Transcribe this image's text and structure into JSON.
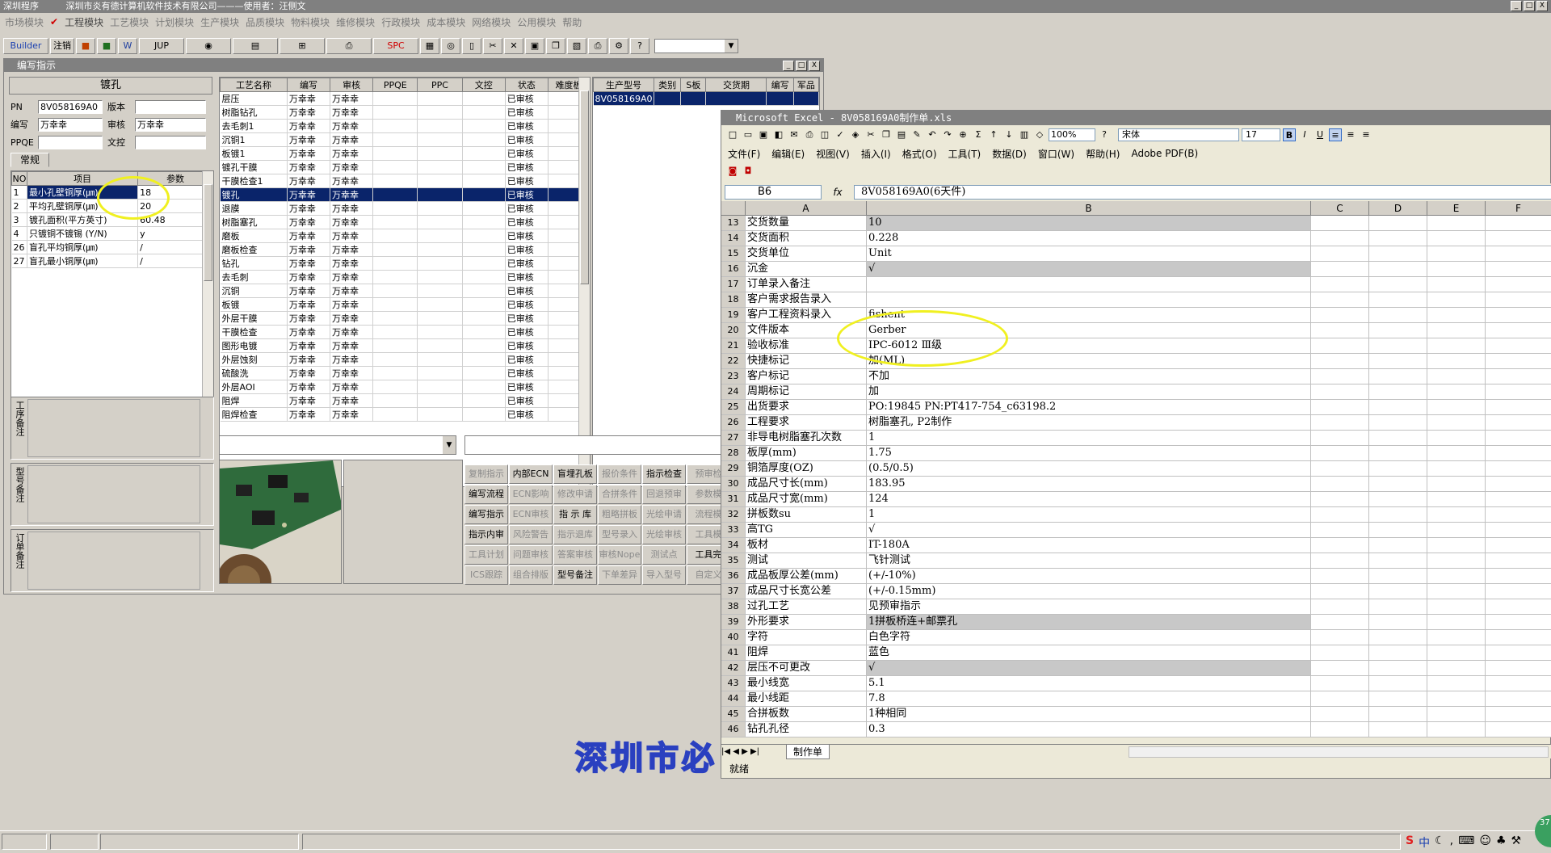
{
  "app": {
    "title": "深圳程序",
    "company_line": "深圳市炎有德计算机软件技术有限公司———使用者：汪侧文",
    "window_btn_min": "_",
    "window_btn_max": "□",
    "window_btn_close": "X"
  },
  "menu": [
    "市场模块",
    "工程模块",
    "工艺模块",
    "计划模块",
    "生产模块",
    "品质模块",
    "物料模块",
    "维修模块",
    "行政模块",
    "成本模块",
    "网络模块",
    "公用模块",
    "帮助"
  ],
  "toolbar": {
    "builder": "Builder",
    "note": "注销",
    "jup": "JUP",
    "spc": "SPC",
    "combo_value": ""
  },
  "panel": {
    "title": "编写指示",
    "section_title": "镀孔",
    "fields": {
      "pn_label": "PN",
      "pn_value": "8V058169A0",
      "version_label": "版本",
      "version_value": "",
      "author_label": "编写",
      "author_value": "万幸幸",
      "review_label": "审核",
      "review_value": "万幸幸",
      "ppqe_label": "PPQE",
      "ppqe_value": "",
      "control_label": "文控",
      "control_value": ""
    },
    "tab": "常规",
    "params_headers": [
      "NO",
      "项目",
      "参数"
    ],
    "params": [
      {
        "no": "1",
        "item": "最小孔壁铜厚(㎛)",
        "val": "18"
      },
      {
        "no": "2",
        "item": "平均孔壁铜厚(㎛)",
        "val": "20"
      },
      {
        "no": "3",
        "item": "镀孔面积(平方英寸)",
        "val": "60.48"
      },
      {
        "no": "4",
        "item": "只镀铜不镀锡 (Y/N)",
        "val": "y"
      },
      {
        "no": "26",
        "item": "盲孔平均铜厚(㎛)",
        "val": "/"
      },
      {
        "no": "27",
        "item": "盲孔最小铜厚(㎛)",
        "val": "/"
      }
    ],
    "memo_labels": [
      "工序备注",
      "型号备注",
      "订单备注"
    ]
  },
  "process": {
    "headers": [
      "工艺名称",
      "编写",
      "审核",
      "PPQE",
      "PPC",
      "文控",
      "状态",
      "难度板"
    ],
    "rows": [
      [
        "层压",
        "万幸幸",
        "万幸幸",
        "",
        "",
        "",
        "已审核",
        ""
      ],
      [
        "树脂钻孔",
        "万幸幸",
        "万幸幸",
        "",
        "",
        "",
        "已审核",
        ""
      ],
      [
        "去毛刺1",
        "万幸幸",
        "万幸幸",
        "",
        "",
        "",
        "已审核",
        ""
      ],
      [
        "沉铜1",
        "万幸幸",
        "万幸幸",
        "",
        "",
        "",
        "已审核",
        ""
      ],
      [
        "板镀1",
        "万幸幸",
        "万幸幸",
        "",
        "",
        "",
        "已审核",
        ""
      ],
      [
        "镀孔干膜",
        "万幸幸",
        "万幸幸",
        "",
        "",
        "",
        "已审核",
        ""
      ],
      [
        "干膜检查1",
        "万幸幸",
        "万幸幸",
        "",
        "",
        "",
        "已审核",
        ""
      ],
      [
        "镀孔",
        "万幸幸",
        "万幸幸",
        "",
        "",
        "",
        "已审核",
        ""
      ],
      [
        "退膜",
        "万幸幸",
        "万幸幸",
        "",
        "",
        "",
        "已审核",
        ""
      ],
      [
        "树脂塞孔",
        "万幸幸",
        "万幸幸",
        "",
        "",
        "",
        "已审核",
        ""
      ],
      [
        "磨板",
        "万幸幸",
        "万幸幸",
        "",
        "",
        "",
        "已审核",
        ""
      ],
      [
        "磨板检查",
        "万幸幸",
        "万幸幸",
        "",
        "",
        "",
        "已审核",
        ""
      ],
      [
        "钻孔",
        "万幸幸",
        "万幸幸",
        "",
        "",
        "",
        "已审核",
        ""
      ],
      [
        "去毛刺",
        "万幸幸",
        "万幸幸",
        "",
        "",
        "",
        "已审核",
        ""
      ],
      [
        "沉铜",
        "万幸幸",
        "万幸幸",
        "",
        "",
        "",
        "已审核",
        ""
      ],
      [
        "板镀",
        "万幸幸",
        "万幸幸",
        "",
        "",
        "",
        "已审核",
        ""
      ],
      [
        "外层干膜",
        "万幸幸",
        "万幸幸",
        "",
        "",
        "",
        "已审核",
        ""
      ],
      [
        "干膜检查",
        "万幸幸",
        "万幸幸",
        "",
        "",
        "",
        "已审核",
        ""
      ],
      [
        "图形电镀",
        "万幸幸",
        "万幸幸",
        "",
        "",
        "",
        "已审核",
        ""
      ],
      [
        "外层蚀刻",
        "万幸幸",
        "万幸幸",
        "",
        "",
        "",
        "已审核",
        ""
      ],
      [
        "硫酸洗",
        "万幸幸",
        "万幸幸",
        "",
        "",
        "",
        "已审核",
        ""
      ],
      [
        "外层AOI",
        "万幸幸",
        "万幸幸",
        "",
        "",
        "",
        "已审核",
        ""
      ],
      [
        "阻焊",
        "万幸幸",
        "万幸幸",
        "",
        "",
        "",
        "已审核",
        ""
      ],
      [
        "阻焊检查",
        "万幸幸",
        "万幸幸",
        "",
        "",
        "",
        "已审核",
        ""
      ]
    ],
    "selected_index": 7
  },
  "production": {
    "headers": [
      "生产型号",
      "类别",
      "S板",
      "交货期",
      "编写",
      "军品"
    ],
    "rows": [
      [
        "8V058169A0",
        "",
        "",
        "",
        "",
        ""
      ]
    ]
  },
  "action_buttons": [
    {
      "label": "复制指示",
      "enabled": false
    },
    {
      "label": "内部ECN",
      "enabled": true
    },
    {
      "label": "盲埋孔板",
      "enabled": true
    },
    {
      "label": "报价条件",
      "enabled": false
    },
    {
      "label": "指示检查",
      "enabled": true
    },
    {
      "label": "预审检",
      "enabled": false
    },
    {
      "label": "编写流程",
      "enabled": true
    },
    {
      "label": "ECN影响",
      "enabled": false
    },
    {
      "label": "修改申请",
      "enabled": false
    },
    {
      "label": "合拼条件",
      "enabled": false
    },
    {
      "label": "回退预审",
      "enabled": false
    },
    {
      "label": "参数模",
      "enabled": false
    },
    {
      "label": "编写指示",
      "enabled": true
    },
    {
      "label": "ECN审核",
      "enabled": false
    },
    {
      "label": "指 示 库",
      "enabled": true
    },
    {
      "label": "粗略拼板",
      "enabled": false
    },
    {
      "label": "光绘申请",
      "enabled": false
    },
    {
      "label": "流程模",
      "enabled": false
    },
    {
      "label": "指示内审",
      "enabled": true
    },
    {
      "label": "风险警告",
      "enabled": false
    },
    {
      "label": "指示退库",
      "enabled": false
    },
    {
      "label": "型号录入",
      "enabled": false
    },
    {
      "label": "光绘审核",
      "enabled": false
    },
    {
      "label": "工具模",
      "enabled": false
    },
    {
      "label": "工具计划",
      "enabled": false
    },
    {
      "label": "问题审核",
      "enabled": false
    },
    {
      "label": "答案审核",
      "enabled": false
    },
    {
      "label": "审核Nope",
      "enabled": false
    },
    {
      "label": "测试点",
      "enabled": false
    },
    {
      "label": "工具完",
      "enabled": true
    },
    {
      "label": "ICS跟踪",
      "enabled": false
    },
    {
      "label": "组合排版",
      "enabled": false
    },
    {
      "label": "型号备注",
      "enabled": true
    },
    {
      "label": "下单差异",
      "enabled": false
    },
    {
      "label": "导入型号",
      "enabled": false
    },
    {
      "label": "自定义",
      "enabled": false
    }
  ],
  "excel": {
    "title": "Microsoft Excel - 8V058169A0制作单.xls",
    "zoom": "100%",
    "font_name": "宋体",
    "font_size": "17",
    "menu": [
      "文件(F)",
      "编辑(E)",
      "视图(V)",
      "插入(I)",
      "格式(O)",
      "工具(T)",
      "数据(D)",
      "窗口(W)",
      "帮助(H)",
      "Adobe PDF(B)"
    ],
    "name_box": "B6",
    "fx": "fx",
    "formula": "8V058169A0(6天件)",
    "columns": [
      "A",
      "B",
      "C",
      "D",
      "E",
      "F"
    ],
    "rows": [
      {
        "n": "13",
        "a": "交货数量",
        "b": "10",
        "gray": true
      },
      {
        "n": "14",
        "a": "交货面积",
        "b": "0.228",
        "gray": false
      },
      {
        "n": "15",
        "a": "交货单位",
        "b": "Unit",
        "gray": false
      },
      {
        "n": "16",
        "a": "沉金",
        "b": "√",
        "gray": true
      },
      {
        "n": "17",
        "a": "订单录入备注",
        "b": "",
        "gray": false
      },
      {
        "n": "18",
        "a": "客户需求报告录入",
        "b": "",
        "gray": false
      },
      {
        "n": "19",
        "a": "客户工程资料录入",
        "b": "fishent",
        "gray": false
      },
      {
        "n": "20",
        "a": "文件版本",
        "b": "Gerber",
        "gray": false
      },
      {
        "n": "21",
        "a": "验收标准",
        "b": "IPC-6012 Ⅲ级",
        "gray": false
      },
      {
        "n": "22",
        "a": "快捷标记",
        "b": "加(ML)",
        "gray": false
      },
      {
        "n": "23",
        "a": "客户标记",
        "b": "不加",
        "gray": false
      },
      {
        "n": "24",
        "a": "周期标记",
        "b": "加",
        "gray": false
      },
      {
        "n": "25",
        "a": "出货要求",
        "b": "PO:19845 PN:PT417-754_c63198.2",
        "gray": false
      },
      {
        "n": "26",
        "a": "工程要求",
        "b": "树脂塞孔, P2制作",
        "gray": false
      },
      {
        "n": "27",
        "a": "非导电树脂塞孔次数",
        "b": "1",
        "gray": false
      },
      {
        "n": "28",
        "a": "板厚(mm)",
        "b": "1.75",
        "gray": false
      },
      {
        "n": "29",
        "a": "铜箔厚度(OZ)",
        "b": "(0.5/0.5)",
        "gray": false
      },
      {
        "n": "30",
        "a": "成品尺寸长(mm)",
        "b": "183.95",
        "gray": false
      },
      {
        "n": "31",
        "a": "成品尺寸宽(mm)",
        "b": "124",
        "gray": false
      },
      {
        "n": "32",
        "a": "拼板数su",
        "b": "1",
        "gray": false
      },
      {
        "n": "33",
        "a": "高TG",
        "b": "√",
        "gray": false
      },
      {
        "n": "34",
        "a": "板材",
        "b": "IT-180A",
        "gray": false
      },
      {
        "n": "35",
        "a": "测试",
        "b": "飞针测试",
        "gray": false
      },
      {
        "n": "36",
        "a": "成品板厚公差(mm)",
        "b": "(+/-10%)",
        "gray": false
      },
      {
        "n": "37",
        "a": "成品尺寸长宽公差",
        "b": "(+/-0.15mm)",
        "gray": false
      },
      {
        "n": "38",
        "a": "过孔工艺",
        "b": "见预审指示",
        "gray": false
      },
      {
        "n": "39",
        "a": "外形要求",
        "b": "1拼板桥连+邮票孔",
        "gray": true
      },
      {
        "n": "40",
        "a": "字符",
        "b": "白色字符",
        "gray": false
      },
      {
        "n": "41",
        "a": "阻焊",
        "b": "蓝色",
        "gray": false
      },
      {
        "n": "42",
        "a": "层压不可更改",
        "b": "√",
        "gray": true
      },
      {
        "n": "43",
        "a": "最小线宽",
        "b": "5.1",
        "gray": false
      },
      {
        "n": "44",
        "a": "最小线距",
        "b": "7.8",
        "gray": false
      },
      {
        "n": "45",
        "a": "合拼板数",
        "b": "1种相同",
        "gray": false
      },
      {
        "n": "46",
        "a": "钻孔孔径",
        "b": "0.3",
        "gray": false
      }
    ],
    "sheet_tab": "制作单",
    "status": "就绪"
  },
  "watermark": "深圳市必",
  "tray": {
    "ime": "中",
    "badge": "37"
  },
  "colors": {
    "selection": "#0a246a",
    "highlight_circle": "#f0f020",
    "desktop": "#d4d0c8"
  }
}
